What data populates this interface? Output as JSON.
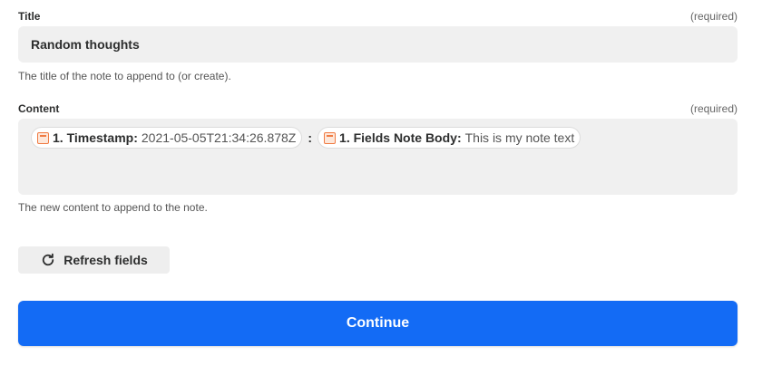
{
  "title_field": {
    "label": "Title",
    "required": "(required)",
    "value": "Random thoughts",
    "help": "The title of the note to append to (or create)."
  },
  "content_field": {
    "label": "Content",
    "required": "(required)",
    "pills": [
      {
        "key": "1. Timestamp:",
        "value": "2021-05-05T21:34:26.878Z",
        "icon": "app-icon"
      },
      {
        "key": "1. Fields Note Body:",
        "value": "This is my note text",
        "icon": "app-icon"
      }
    ],
    "separator": ":",
    "help": "The new content to append to the note."
  },
  "refresh_button": {
    "label": "Refresh fields",
    "icon": "refresh-icon"
  },
  "continue_button": {
    "label": "Continue",
    "color": "#136bf5"
  }
}
